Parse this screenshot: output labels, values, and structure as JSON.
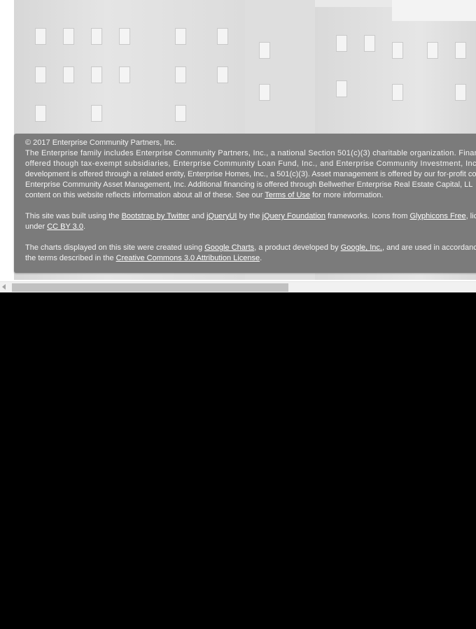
{
  "footer": {
    "copyright": "© 2017 Enterprise Community Partners, Inc.",
    "para1": {
      "line1": "The Enterprise family includes Enterprise Community Partners, Inc., a national Section 501(c)(3) charitable organization. Finan",
      "line2": "offered though tax-exempt subsidiaries, Enterprise Community Loan Fund, Inc., and Enterprise Community Investment, Inc. H",
      "line3": "development is offered through a related entity, Enterprise Homes, Inc., a 501(c)(3). Asset management is offered by our for-profit co",
      "line4": "Enterprise Community Asset Management, Inc. Additional financing is offered through Bellwether Enterprise Real Estate Capital, LL",
      "line5_pre": "content on this website reflects information about all of these. See our ",
      "terms_link": "Terms of Use",
      "line5_post": " for more information."
    },
    "para2": {
      "t1": "This site was built using the ",
      "bootstrap_link": "Bootstrap by Twitter",
      "t2": " and ",
      "jqueryui_link": "jQueryUI",
      "t3": " by the ",
      "jqfoundation_link": "jQuery Foundation",
      "t4": " frameworks. Icons from ",
      "glyphicons_link": "Glyphicons Free",
      "t5": ", lic",
      "t6": "under ",
      "ccby_link": "CC BY 3.0",
      "t7": "."
    },
    "para3": {
      "t1": "The charts displayed on this site were created using ",
      "gcharts_link": "Google Charts",
      "t2": ", a product developed by ",
      "google_link": "Google, Inc.",
      "t3": ", and are used in accordanc",
      "t4": "the terms described in the ",
      "cc_link": "Creative Commons 3.0 Attribution License",
      "t5": "."
    }
  }
}
